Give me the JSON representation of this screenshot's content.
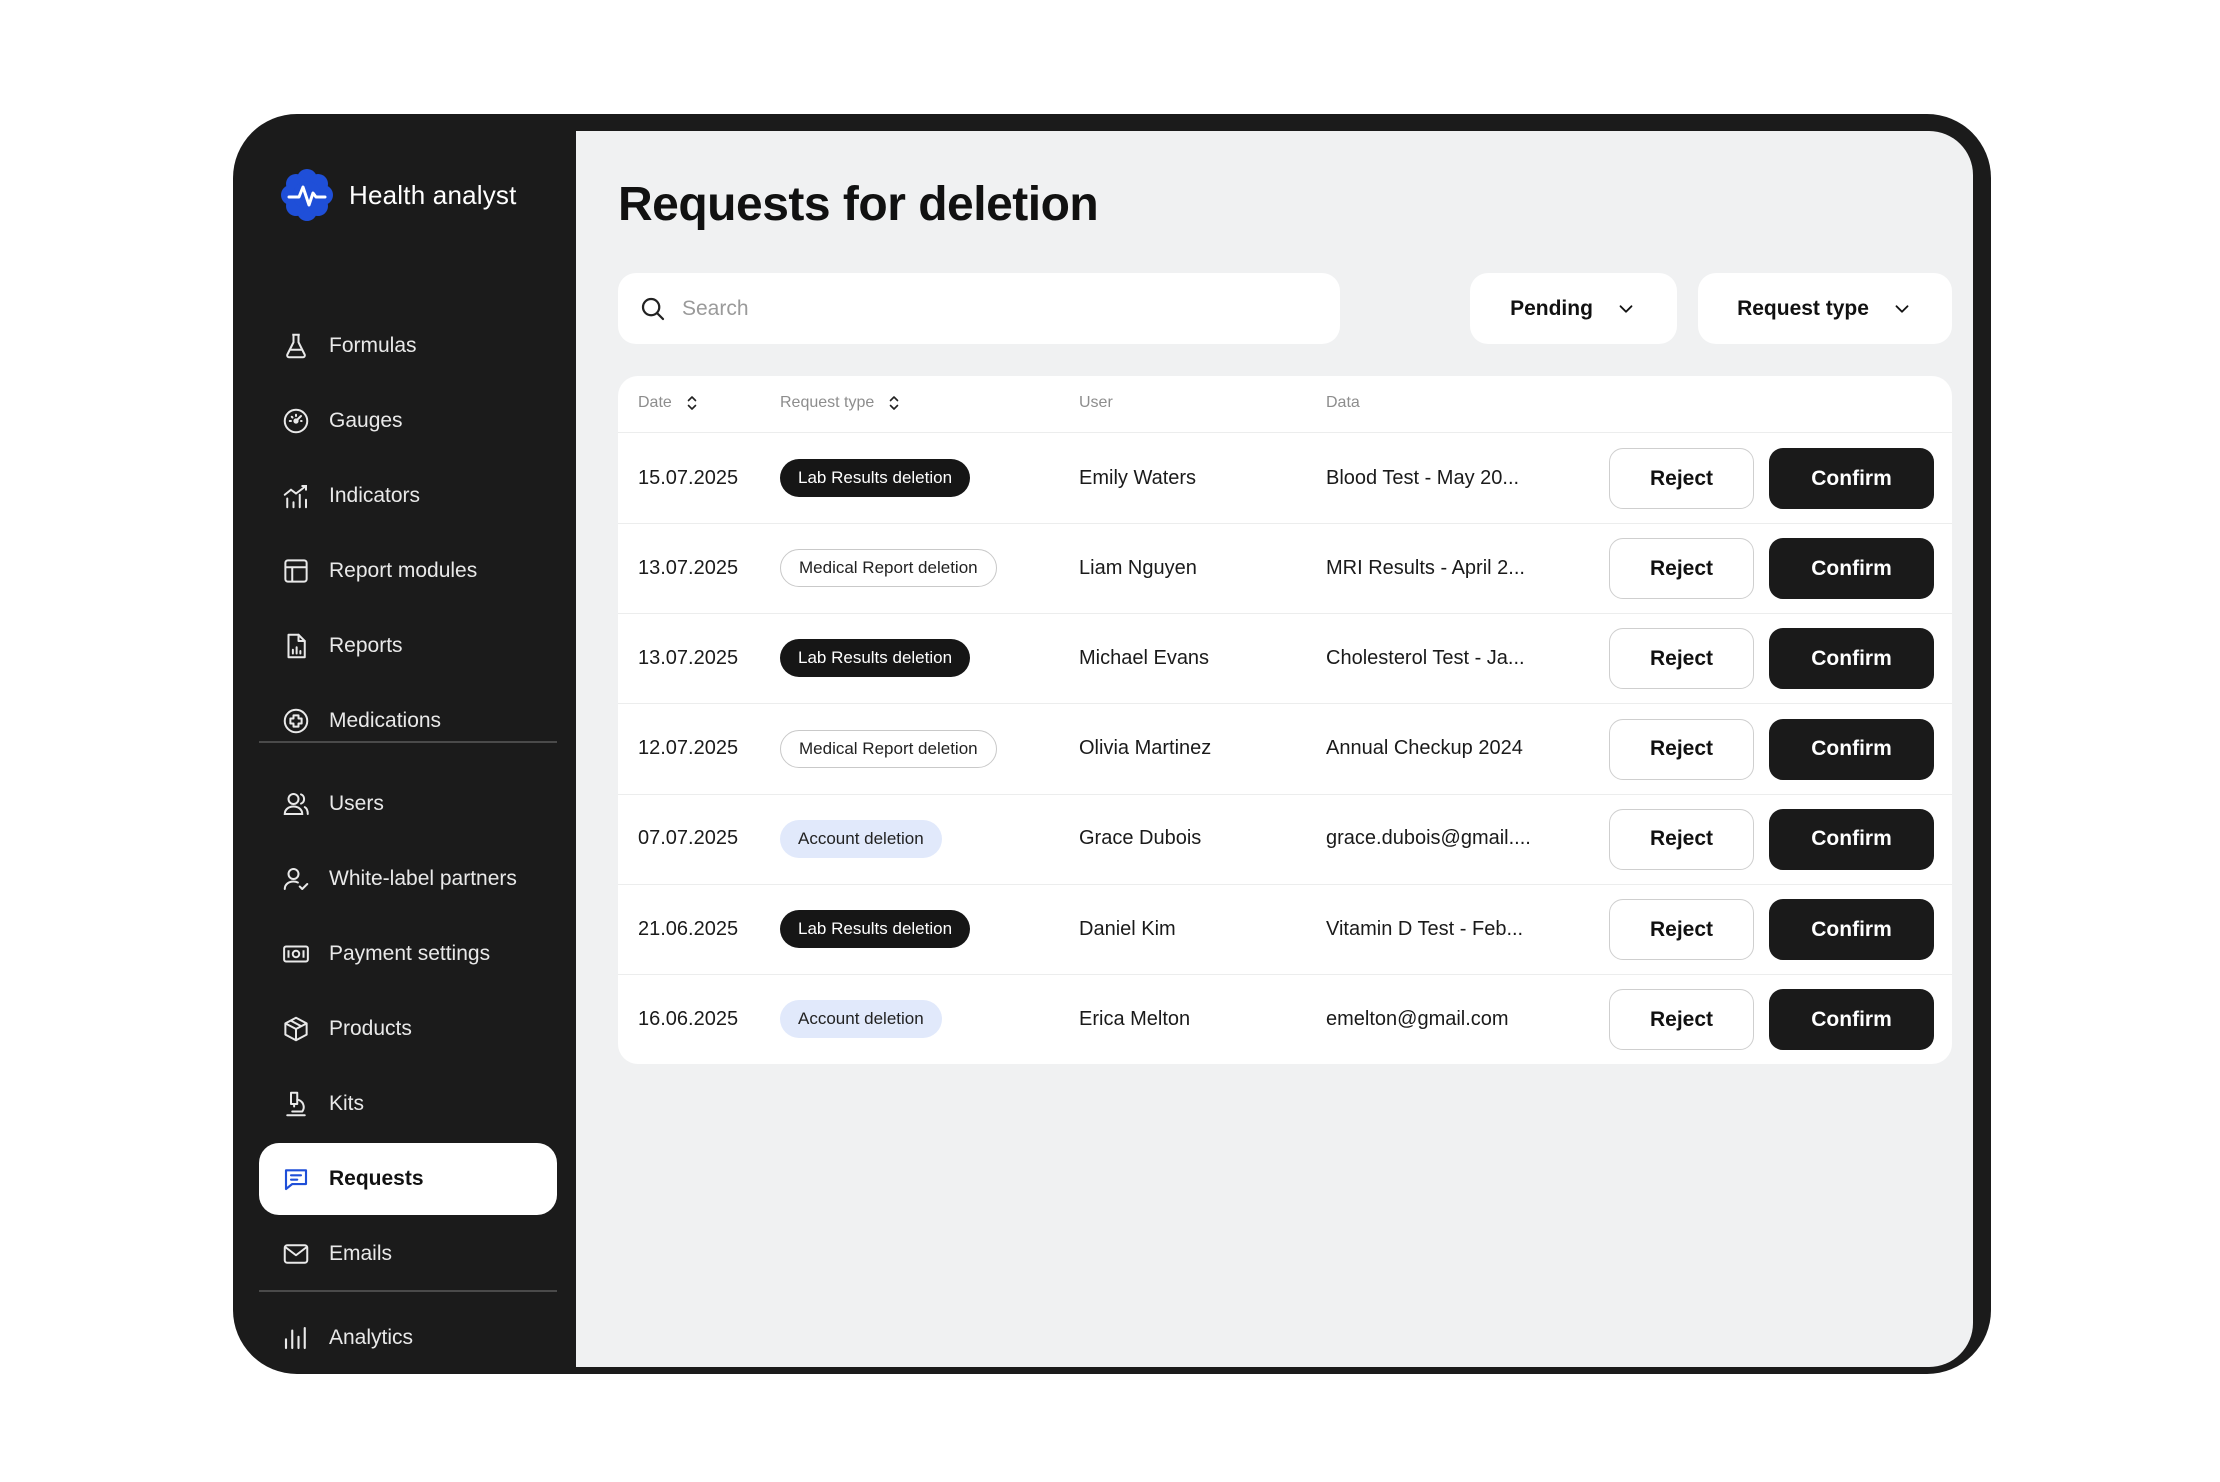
{
  "brand": {
    "name": "Health analyst",
    "logo_icon": "health-logo-icon",
    "accent": "#1f4fd8"
  },
  "sidebar": {
    "items": [
      {
        "label": "Formulas",
        "icon": "flask-icon"
      },
      {
        "label": "Gauges",
        "icon": "gauge-icon"
      },
      {
        "label": "Indicators",
        "icon": "indicators-icon"
      },
      {
        "label": "Report modules",
        "icon": "layout-icon"
      },
      {
        "label": "Reports",
        "icon": "report-chart-icon"
      },
      {
        "label": "Medications",
        "icon": "medical-cross-icon"
      },
      {
        "label": "Users",
        "icon": "users-icon"
      },
      {
        "label": "White-label partners",
        "icon": "user-check-icon"
      },
      {
        "label": "Payment settings",
        "icon": "banknote-icon"
      },
      {
        "label": "Products",
        "icon": "box-icon"
      },
      {
        "label": "Kits",
        "icon": "kit-icon"
      },
      {
        "label": "Requests",
        "icon": "message-icon",
        "active": true
      },
      {
        "label": "Emails",
        "icon": "mail-icon"
      },
      {
        "label": "Analytics",
        "icon": "bar-chart-icon"
      }
    ]
  },
  "main": {
    "title": "Requests for deletion",
    "search": {
      "placeholder": "Search",
      "value": ""
    },
    "filters": {
      "status": "Pending",
      "type": "Request type"
    },
    "table": {
      "columns": [
        "Date",
        "Request type",
        "User",
        "Data"
      ],
      "reject_label": "Reject",
      "confirm_label": "Confirm",
      "rows": [
        {
          "date": "15.07.2025",
          "type": "Lab Results deletion",
          "kind": "lab",
          "user": "Emily Waters",
          "data": "Blood Test - May 20..."
        },
        {
          "date": "13.07.2025",
          "type": "Medical Report deletion",
          "kind": "med",
          "user": "Liam Nguyen",
          "data": "MRI Results - April 2..."
        },
        {
          "date": "13.07.2025",
          "type": "Lab Results deletion",
          "kind": "lab",
          "user": "Michael Evans",
          "data": "Cholesterol Test - Ja..."
        },
        {
          "date": "12.07.2025",
          "type": "Medical Report deletion",
          "kind": "med",
          "user": "Olivia Martinez",
          "data": "Annual Checkup 2024"
        },
        {
          "date": "07.07.2025",
          "type": "Account deletion",
          "kind": "acc",
          "user": "Grace Dubois",
          "data": "grace.dubois@gmail...."
        },
        {
          "date": "21.06.2025",
          "type": "Lab Results deletion",
          "kind": "lab",
          "user": "Daniel Kim",
          "data": "Vitamin D Test - Feb..."
        },
        {
          "date": "16.06.2025",
          "type": "Account deletion",
          "kind": "acc",
          "user": "Erica Melton",
          "data": "emelton@gmail.com"
        }
      ]
    }
  }
}
